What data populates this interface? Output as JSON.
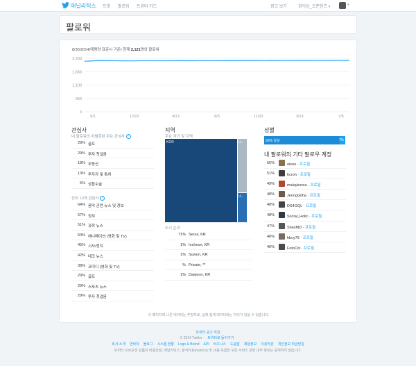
{
  "topbar": {
    "brand": "애널리틱스",
    "nav": [
      "트윗",
      "팔로워",
      "트위터 카드"
    ],
    "ads_link": "광고 보기",
    "user_label": "희익상_오픈헌즈"
  },
  "page_title": "팔로워",
  "chart": {
    "caption_date": "8/30/2014(태평양 표준시 기준) 현재",
    "caption_count": "2,121",
    "caption_suffix": "명의 팔로워"
  },
  "chart_data": {
    "type": "line",
    "x": [
      "9/1",
      "12/22",
      "4/13",
      "8/3",
      "11/23",
      "3/15",
      "7/5"
    ],
    "ylim": [
      0,
      2200
    ],
    "yticks": [
      "2,200",
      "1,650",
      "1,100",
      "550",
      "0"
    ],
    "series": [
      {
        "values": [
          2080,
          2110,
          2100,
          2095,
          2102,
          2098,
          2104,
          2100,
          2106,
          2103,
          2108,
          2110,
          2107,
          2112,
          2115,
          2113,
          2118,
          2121
        ]
      }
    ],
    "color": "#1da1f2",
    "grid": true
  },
  "interests": {
    "title": "관심사",
    "subtitle": "내 팔로워의 차별화된 주요 관심사",
    "unique": [
      {
        "pct": "29%",
        "label": "골프"
      },
      {
        "pct": "29%",
        "label": "투자 첫걸음"
      },
      {
        "pct": "18%",
        "label": "부동산"
      },
      {
        "pct": "13%",
        "label": "투자자 및 톡허"
      },
      {
        "pct": "5%",
        "label": "상황수술"
      }
    ],
    "top_subtitle": "상위 10개 관심사",
    "top": [
      {
        "pct": "64%",
        "label": "음악 관련 뉴스 및 정보"
      },
      {
        "pct": "57%",
        "label": "정치"
      },
      {
        "pct": "51%",
        "label": "과학 뉴스"
      },
      {
        "pct": "50%",
        "label": "애니메이션 (영화 및 TV)"
      },
      {
        "pct": "45%",
        "label": "시사/정치"
      },
      {
        "pct": "42%",
        "label": "테크 뉴스"
      },
      {
        "pct": "38%",
        "label": "코미디 (영화 및 TV)"
      },
      {
        "pct": "29%",
        "label": "골프"
      },
      {
        "pct": "29%",
        "label": "스포츠 뉴스"
      },
      {
        "pct": "29%",
        "label": "투자 첫걸음"
      }
    ]
  },
  "location": {
    "title": "지역",
    "subtitle": "주요 국가 및 지역",
    "treemap_labels": [
      "KOR",
      "U..",
      "U.."
    ],
    "cities_title": "도시 순위",
    "cities": [
      {
        "pct": "71%",
        "label": "Seoul, KR"
      },
      {
        "pct": "1%",
        "label": "Incheon, KR"
      },
      {
        "pct": "1%",
        "label": "Suwon, KR"
      },
      {
        "pct": "%",
        "label": "Private, **"
      },
      {
        "pct": "1%",
        "label": "Daejeon, KR"
      }
    ]
  },
  "gender": {
    "title": "성별",
    "male_label": "93% 남성",
    "female_label": "7%",
    "male_fraction": 0.93
  },
  "other_accounts": {
    "title": "내 팔로워의 기타 팔로우 계정",
    "profile_link": "프로필",
    "items": [
      {
        "pct": "55%",
        "name": "oisoo",
        "color": "#8a6f55"
      },
      {
        "pct": "51%",
        "name": "hcroh",
        "color": "#3d3d3d"
      },
      {
        "pct": "49%",
        "name": "malaykorea",
        "color": "#b4452f"
      },
      {
        "pct": "48%",
        "name": "JeongGilha",
        "color": "#6e5a4b"
      },
      {
        "pct": "48%",
        "name": "DS4GQL",
        "color": "#444"
      },
      {
        "pct": "48%",
        "name": "Social_Holic",
        "color": "#2f3a44"
      },
      {
        "pct": "47%",
        "name": "ShesMD",
        "color": "#555"
      },
      {
        "pct": "46%",
        "name": "hbcy79",
        "color": "#7b6a63"
      },
      {
        "pct": "46%",
        "name": "FotoCiti",
        "color": "#4a4a4a"
      }
    ]
  },
  "notice": "이 페이지에 나온 데이터는 추정치로, 실제 집계 데이터와는 차이가 있을 수 있습니다.",
  "footer": {
    "ads_link": "트위터 광고 약관",
    "copyright": "© 2014 Twitter",
    "back_link": "트위터로 돌아가기",
    "links": [
      "회사 소개",
      "연락처",
      "블로그",
      "시스템 현황",
      "Logo & Brand",
      "API",
      "비즈니스",
      "도움말",
      "채용정보",
      "이용약관",
      "개인정보 취급방침"
    ],
    "legal": "트위터 프로모션 상품의 비용산정, 애널리틱스, 분석지표(metrics) 및 UI를 포함한 모든 서비스 관련 내부 정보는 공개하지 않습니다."
  }
}
